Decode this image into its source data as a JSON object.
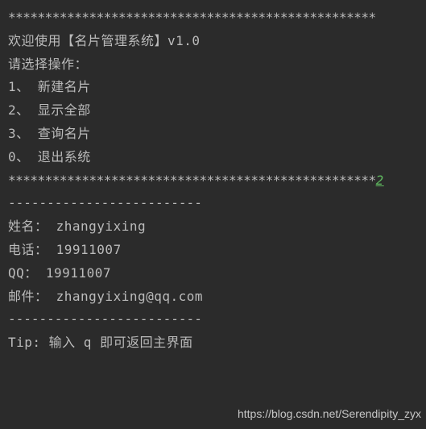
{
  "border_top": "**************************************************",
  "welcome": "欢迎使用【名片管理系统】v1.0",
  "blank": "",
  "prompt_select": "请选择操作：",
  "menu": {
    "item1": "1、 新建名片",
    "item2": "2、 显示全部",
    "item3": "3、 查询名片",
    "item0": "0、 退出系统"
  },
  "border_bottom": "**************************************************",
  "user_input": "2",
  "separator1": "-------------------------",
  "record": {
    "name_line": "姓名： zhangyixing",
    "phone_line": "电话： 19911007",
    "qq_line": "QQ： 19911007",
    "email_line": "邮件： zhangyixing@qq.com"
  },
  "separator2": "-------------------------",
  "tip": "Tip: 输入 q 即可返回主界面",
  "watermark": "https://blog.csdn.net/Serendipity_zyx"
}
